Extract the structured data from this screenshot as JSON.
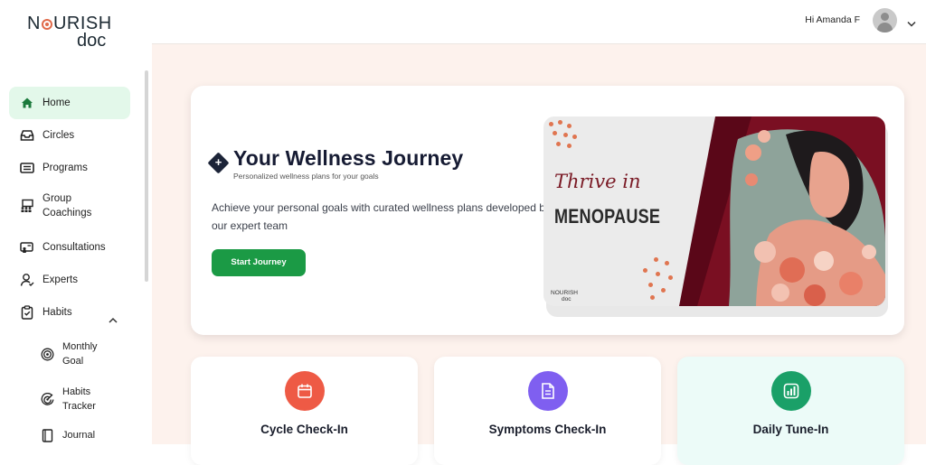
{
  "logo": {
    "line1_pre": "N",
    "line1_post": "URISH",
    "line2": "doc"
  },
  "header": {
    "greeting": "Hi Amanda F"
  },
  "sidebar": {
    "items": [
      {
        "label": "Home",
        "icon": "home-icon"
      },
      {
        "label": "Circles",
        "icon": "inbox-icon"
      },
      {
        "label": "Programs",
        "icon": "list-icon"
      },
      {
        "label": "Group Coachings",
        "icon": "group-icon"
      },
      {
        "label": "Consultations",
        "icon": "chat-icon"
      },
      {
        "label": "Experts",
        "icon": "user-icon"
      },
      {
        "label": "Habits",
        "icon": "clipboard-icon"
      }
    ],
    "sub_items": [
      {
        "label": "Monthly Goal",
        "icon": "target-icon"
      },
      {
        "label": "Habits Tracker",
        "icon": "radar-icon"
      },
      {
        "label": "Journal",
        "icon": "notebook-icon"
      }
    ]
  },
  "hero": {
    "title": "Your Wellness Journey",
    "subtitle": "Personalized wellness plans for your goals",
    "description": "Achieve your personal goals with curated wellness plans developed by our expert team",
    "button": "Start Journey",
    "promo_script": "Thrive in",
    "promo_title": "MENOPAUSE",
    "promo_logo_top": "NOURISH",
    "promo_logo_bottom": "doc"
  },
  "cards": [
    {
      "title": "Cycle Check-In",
      "icon": "calendar-icon",
      "color": "#ee5a45"
    },
    {
      "title": "Symptoms Check-In",
      "icon": "document-icon",
      "color": "#7f5ff0"
    },
    {
      "title": "Daily Tune-In",
      "icon": "bar-chart-icon",
      "color": "#1aa068"
    }
  ],
  "colors": {
    "accent_green": "#1b9a45",
    "active_nav_bg": "#e3f8ea",
    "main_bg": "#fdf2ed"
  }
}
